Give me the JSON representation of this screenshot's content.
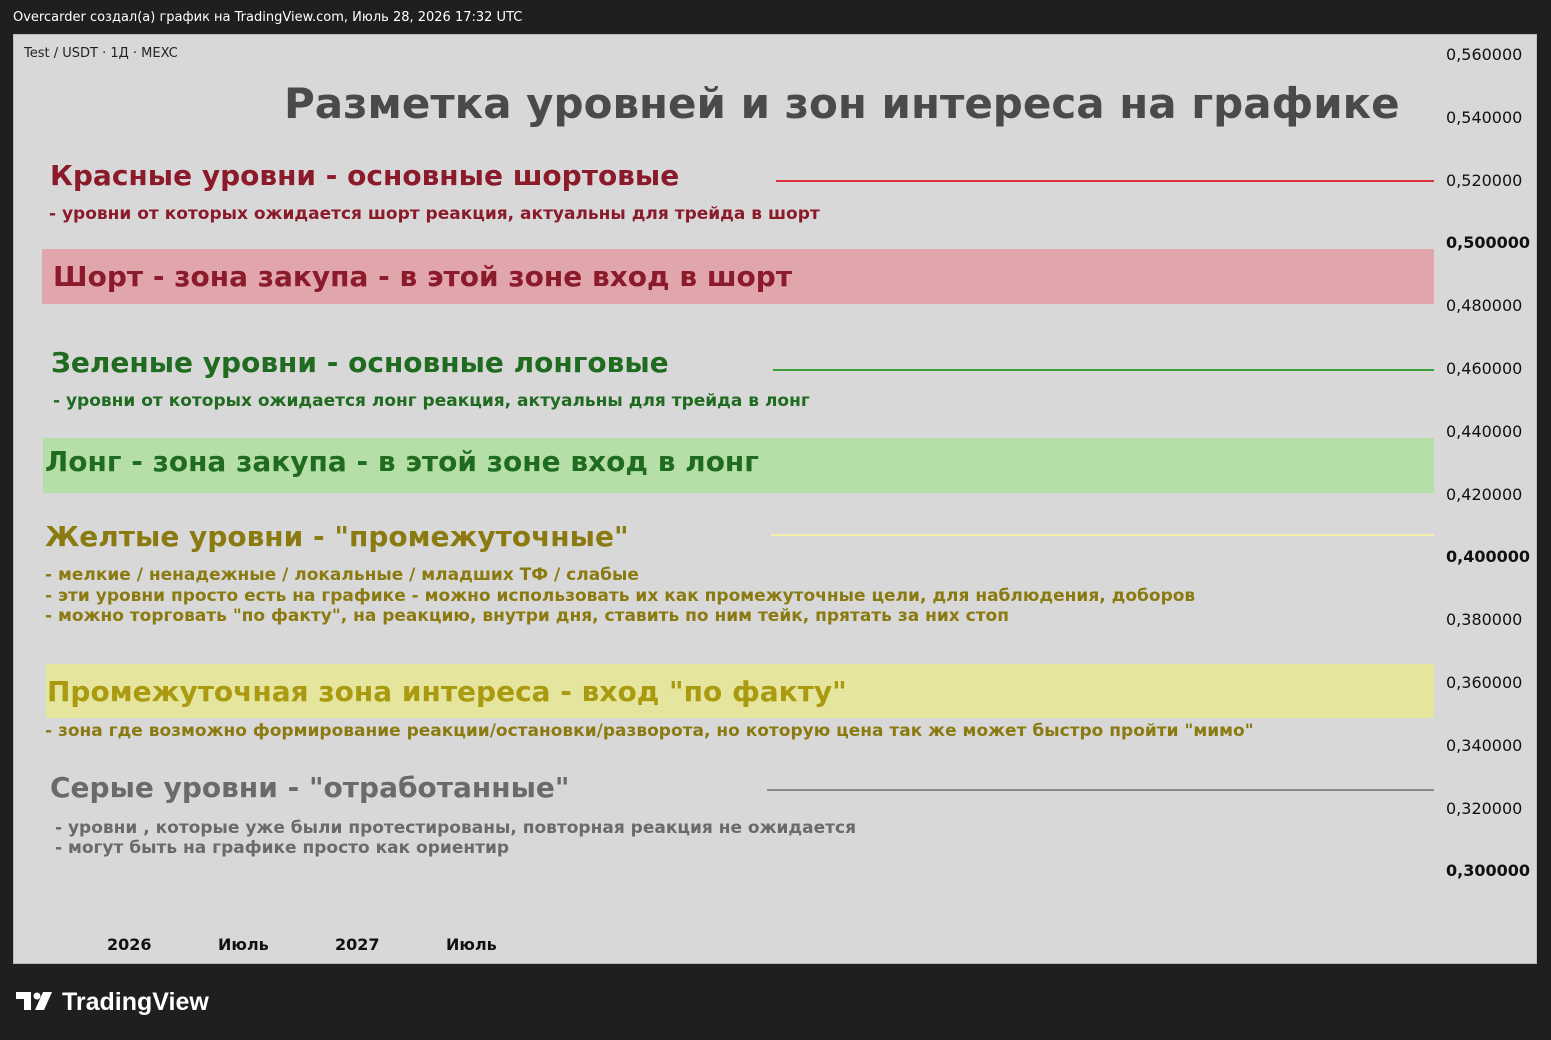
{
  "header": {
    "caption": "Overcarder создал(а) график на TradingView.com, Июль 28, 2026 17:32 UTC"
  },
  "chart": {
    "symbol": "Test / USDT · 1Д · MEXC",
    "title": "Разметка уровней и зон интереса на графике",
    "red": {
      "heading": "Красные уровни - основные шортовые",
      "desc": "- уровни от которых ожидается шорт реакция, актуальны для трейда в шорт",
      "color": "#8b1a2a",
      "line_color": "#e03040"
    },
    "short_zone": {
      "label": "Шорт - зона закупа - в этой зоне вход в шорт",
      "fill": "#e0a6ab",
      "text_color": "#8b1a2a"
    },
    "green": {
      "heading": "Зеленые уровни - основные лонговые",
      "desc": "- уровни от которых ожидается лонг реакция, актуальны для трейда в лонг",
      "color": "#1f6b1f",
      "line_color": "#3aa03a"
    },
    "long_zone": {
      "label": "Лонг - зона закупа - в этой зоне вход в лонг",
      "fill": "#b5dfa6",
      "text_color": "#1f6b1f"
    },
    "yellow": {
      "heading": "Желтые уровни - \"промежуточные\"",
      "desc_lines": [
        "- мелкие / ненадежные / локальные / младших ТФ / слабые",
        "- эти уровни просто есть на графике - можно использовать их как промежуточные цели, для  наблюдения, доборов",
        "- можно торговать \"по факту\", на реакцию, внутри дня, ставить по ним тейк, прятать за них стоп"
      ],
      "color": "#8a7a10",
      "line_color": "#f4f0b0"
    },
    "mid_zone": {
      "label": "Промежуточная зона интереса - вход \"по факту\"",
      "desc": "- зона где возможно формирование реакции/остановки/разворота, но которую цена так же может быстро пройти \"мимо\"",
      "fill": "#e5e59d",
      "text_color": "#a99a10",
      "desc_color": "#8a7a10"
    },
    "gray": {
      "heading": "Серые уровни - \"отработанные\"",
      "desc_lines": [
        "- уровни , которые уже были протестированы, повторная реакция не ожидается",
        "- могут быть на графике просто как ориентир"
      ],
      "color": "#6a6a6a",
      "line_color": "#8a8a8a"
    },
    "price_axis": [
      {
        "label": "0,560000",
        "bold": false
      },
      {
        "label": "0,540000",
        "bold": false
      },
      {
        "label": "0,520000",
        "bold": false
      },
      {
        "label": "0,500000",
        "bold": true
      },
      {
        "label": "0,480000",
        "bold": false
      },
      {
        "label": "0,460000",
        "bold": false
      },
      {
        "label": "0,440000",
        "bold": false
      },
      {
        "label": "0,420000",
        "bold": false
      },
      {
        "label": "0,400000",
        "bold": true
      },
      {
        "label": "0,380000",
        "bold": false
      },
      {
        "label": "0,360000",
        "bold": false
      },
      {
        "label": "0,340000",
        "bold": false
      },
      {
        "label": "0,320000",
        "bold": false
      },
      {
        "label": "0,300000",
        "bold": true
      }
    ],
    "time_axis": [
      "2026",
      "Июль",
      "2027",
      "Июль"
    ]
  },
  "brand": {
    "name": "TradingView",
    "icon": "tradingview-logo-icon"
  }
}
